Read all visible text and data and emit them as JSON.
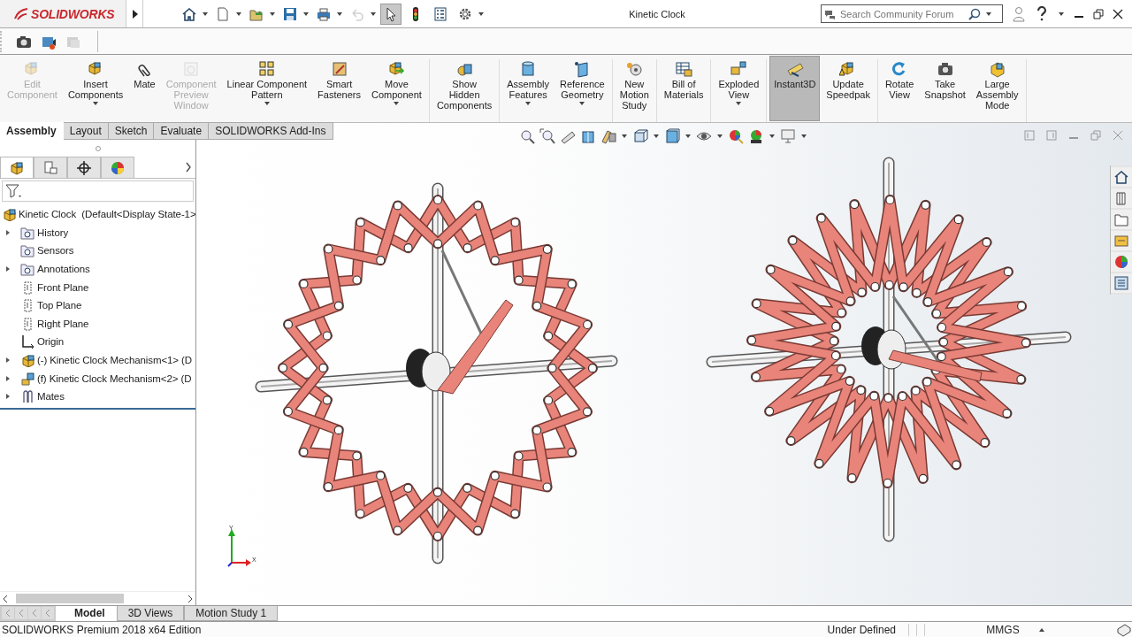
{
  "app": {
    "logo": "SOLIDWORKS",
    "title": "Kinetic Clock"
  },
  "quick_access": [
    {
      "pressed": false,
      "disabled": false
    },
    {
      "pressed": false,
      "disabled": false
    },
    {
      "pressed": false,
      "disabled": false
    },
    {
      "pressed": false,
      "disabled": false
    },
    {
      "pressed": false,
      "disabled": false
    },
    {
      "pressed": false,
      "disabled": true
    },
    {
      "pressed": true,
      "disabled": false
    },
    {
      "pressed": false,
      "disabled": false
    },
    {
      "pressed": false,
      "disabled": false
    },
    {
      "pressed": false,
      "disabled": false
    }
  ],
  "search": {
    "placeholder": "Search Community Forum"
  },
  "ribbon": {
    "groups": [
      [
        {
          "label": "Edit\nComponent",
          "disabled": true,
          "dropdown": false,
          "selected": false
        },
        {
          "label": "Insert\nComponents",
          "disabled": false,
          "dropdown": true,
          "selected": false
        },
        {
          "label": "Mate",
          "disabled": false,
          "dropdown": false,
          "selected": false
        },
        {
          "label": "Component\nPreview\nWindow",
          "disabled": true,
          "dropdown": false,
          "selected": false
        },
        {
          "label": "Linear Component\nPattern",
          "disabled": false,
          "dropdown": true,
          "selected": false
        },
        {
          "label": "Smart\nFasteners",
          "disabled": false,
          "dropdown": false,
          "selected": false
        },
        {
          "label": "Move\nComponent",
          "disabled": false,
          "dropdown": true,
          "selected": false
        }
      ],
      [
        {
          "label": "Show\nHidden\nComponents",
          "disabled": false,
          "dropdown": false,
          "selected": false
        }
      ],
      [
        {
          "label": "Assembly\nFeatures",
          "disabled": false,
          "dropdown": true,
          "selected": false
        },
        {
          "label": "Reference\nGeometry",
          "disabled": false,
          "dropdown": true,
          "selected": false
        }
      ],
      [
        {
          "label": "New\nMotion\nStudy",
          "disabled": false,
          "dropdown": false,
          "selected": false
        }
      ],
      [
        {
          "label": "Bill of\nMaterials",
          "disabled": false,
          "dropdown": false,
          "selected": false
        }
      ],
      [
        {
          "label": "Exploded\nView",
          "disabled": false,
          "dropdown": true,
          "selected": false
        }
      ],
      [
        {
          "label": "Instant3D",
          "disabled": false,
          "dropdown": false,
          "selected": true
        },
        {
          "label": "Update\nSpeedpak",
          "disabled": false,
          "dropdown": false,
          "selected": false
        }
      ],
      [
        {
          "label": "Rotate\nView",
          "disabled": false,
          "dropdown": false,
          "selected": false
        },
        {
          "label": "Take\nSnapshot",
          "disabled": false,
          "dropdown": false,
          "selected": false
        },
        {
          "label": "Large\nAssembly\nMode",
          "disabled": false,
          "dropdown": false,
          "selected": false
        }
      ]
    ]
  },
  "command_tabs": [
    {
      "label": "Assembly",
      "selected": true
    },
    {
      "label": "Layout",
      "selected": false
    },
    {
      "label": "Sketch",
      "selected": false
    },
    {
      "label": "Evaluate",
      "selected": false
    },
    {
      "label": "SOLIDWORKS Add-Ins",
      "selected": false
    }
  ],
  "manager_tabs": [
    {
      "selected": true
    },
    {
      "selected": false
    },
    {
      "selected": false
    },
    {
      "selected": false
    }
  ],
  "tree": {
    "label": "Kinetic Clock  (Default<Display State-1>",
    "kind": "assembly",
    "expandable": false,
    "children": [
      {
        "label": "History",
        "kind": "folder",
        "expandable": true
      },
      {
        "label": "Sensors",
        "kind": "folder",
        "expandable": false
      },
      {
        "label": "Annotations",
        "kind": "folder",
        "expandable": true
      },
      {
        "label": "Front Plane",
        "kind": "plane",
        "expandable": false
      },
      {
        "label": "Top Plane",
        "kind": "plane",
        "expandable": false
      },
      {
        "label": "Right Plane",
        "kind": "plane",
        "expandable": false
      },
      {
        "label": "Origin",
        "kind": "origin",
        "expandable": false
      },
      {
        "label": "(-) Kinetic Clock Mechanism<1> (D",
        "kind": "assembly",
        "expandable": true
      },
      {
        "label": "(f) Kinetic Clock Mechanism<2> (D",
        "kind": "part",
        "expandable": true
      },
      {
        "label": "Mates",
        "kind": "mates",
        "expandable": true
      }
    ]
  },
  "triad": {
    "y": "Y",
    "x": "X"
  },
  "bottom_tabs": [
    {
      "label": "Model",
      "selected": true
    },
    {
      "label": "3D Views",
      "selected": false
    },
    {
      "label": "Motion Study 1",
      "selected": false
    }
  ],
  "status_bar": {
    "edition": "SOLIDWORKS Premium 2018 x64 Edition",
    "state": "Under Defined",
    "units": "MMGS"
  }
}
